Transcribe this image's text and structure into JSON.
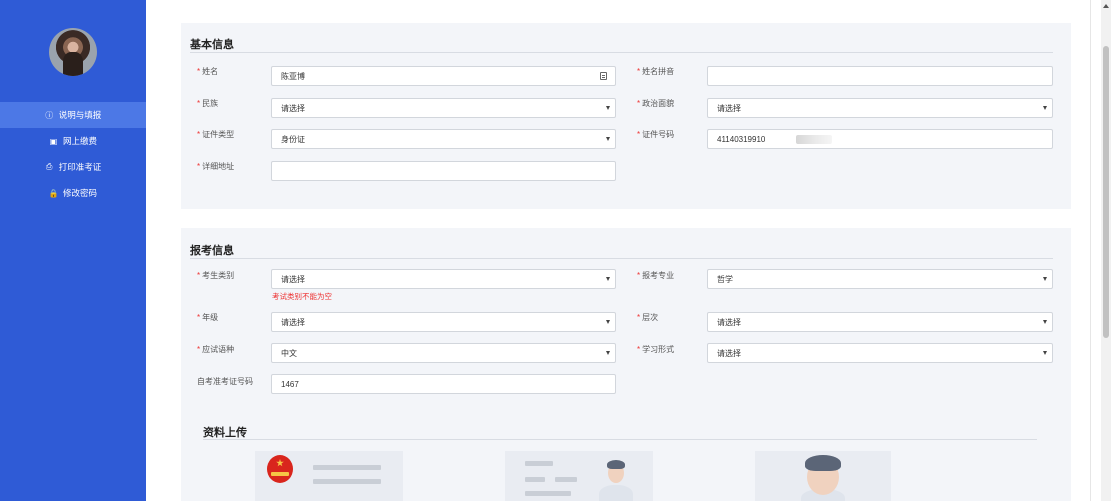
{
  "sidebar": {
    "items": [
      {
        "icon": "info-circle-icon",
        "glyph": "ⓘ",
        "label": "说明与填报",
        "active": true
      },
      {
        "icon": "payment-icon",
        "glyph": "▣",
        "label": "网上缴费",
        "active": false
      },
      {
        "icon": "printer-icon",
        "glyph": "⎙",
        "label": "打印准考证",
        "active": false
      },
      {
        "icon": "lock-icon",
        "glyph": "🔒",
        "label": "修改密码",
        "active": false
      }
    ]
  },
  "basic_info": {
    "title": "基本信息",
    "required_mark": "*",
    "name": {
      "label": "姓名",
      "value": "陈亚博"
    },
    "name_pinyin": {
      "label": "姓名拼音",
      "value": ""
    },
    "ethnicity": {
      "label": "民族",
      "value": "请选择"
    },
    "political_status": {
      "label": "政治面貌",
      "value": "请选择"
    },
    "id_type": {
      "label": "证件类型",
      "value": "身份证"
    },
    "id_number": {
      "label": "证件号码",
      "value": "41140319910"
    },
    "address": {
      "label": "详细地址",
      "value": ""
    }
  },
  "exam_info": {
    "title": "报考信息",
    "candidate_category": {
      "label": "考生类别",
      "value": "请选择",
      "error": "考试类别不能为空"
    },
    "major": {
      "label": "报考专业",
      "value": "哲学"
    },
    "grade": {
      "label": "年级",
      "value": "请选择"
    },
    "level": {
      "label": "层次",
      "value": "请选择"
    },
    "exam_language": {
      "label": "应试语种",
      "value": "中文"
    },
    "study_mode": {
      "label": "学习形式",
      "value": "请选择"
    },
    "admission_number": {
      "label": "自考准考证号码",
      "value": "1467"
    }
  },
  "upload": {
    "title": "资料上传"
  },
  "colors": {
    "sidebar": "#2f5bd6",
    "active_item": "#4c78e6",
    "error": "#e33333",
    "panel_bg": "#f3f5f9"
  }
}
